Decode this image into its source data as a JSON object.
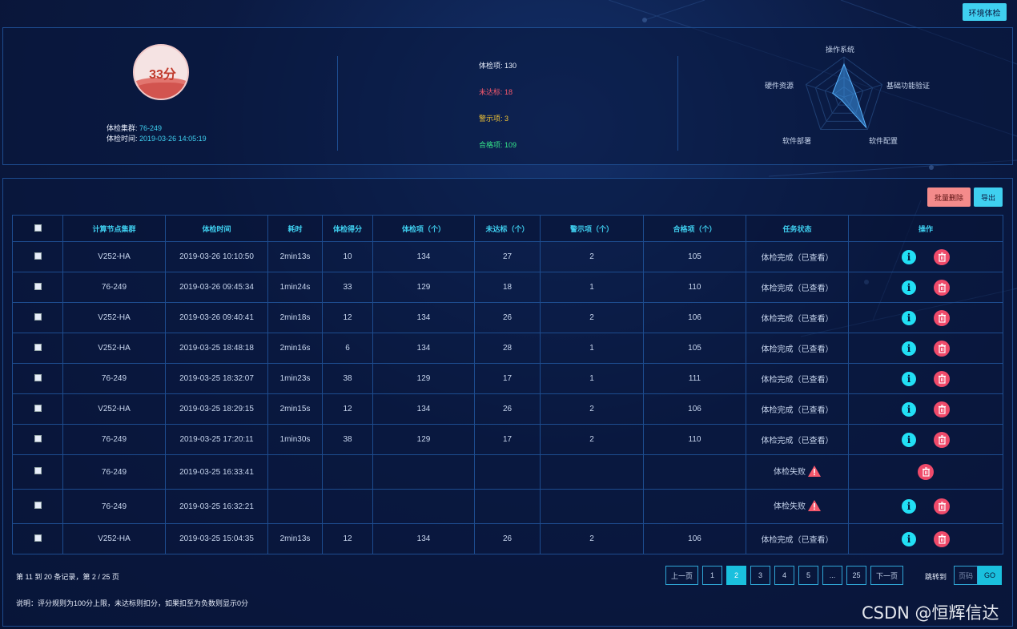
{
  "header": {
    "env_check_button": "环境体检"
  },
  "summary": {
    "score": "33分",
    "cluster_label": "体检集群:",
    "cluster_value": "76-249",
    "time_label": "体检时间:",
    "time_value": "2019-03-26 14:05:19",
    "stats": [
      {
        "label": "体检项:",
        "value": "130",
        "color": "#e8eefb"
      },
      {
        "label": "未达标:",
        "value": "18",
        "color": "#f5586c"
      },
      {
        "label": "警示项:",
        "value": "3",
        "color": "#f3c534"
      },
      {
        "label": "合格项:",
        "value": "109",
        "color": "#35e58a"
      }
    ],
    "radar": {
      "labels": [
        "操作系统",
        "基础功能验证",
        "软件配置",
        "软件部署",
        "硬件资源"
      ],
      "values": [
        0.82,
        0.3,
        0.95,
        0.1,
        0.3
      ]
    }
  },
  "toolbar": {
    "batch_delete": "批量删除",
    "export": "导出"
  },
  "table": {
    "columns": [
      "计算节点集群",
      "体检时间",
      "耗时",
      "体检得分",
      "体检项（个）",
      "未达标（个）",
      "警示项（个）",
      "合格项（个）",
      "任务状态",
      "操作"
    ],
    "rows": [
      {
        "cluster": "V252-HA",
        "time": "2019-03-26 10:10:50",
        "duration": "2min13s",
        "score": "10",
        "items": "134",
        "failed": "27",
        "warnings": "2",
        "passed": "105",
        "status": "体检完成（已查看）",
        "ok": true
      },
      {
        "cluster": "76-249",
        "time": "2019-03-26 09:45:34",
        "duration": "1min24s",
        "score": "33",
        "items": "129",
        "failed": "18",
        "warnings": "1",
        "passed": "110",
        "status": "体检完成（已查看）",
        "ok": true
      },
      {
        "cluster": "V252-HA",
        "time": "2019-03-26 09:40:41",
        "duration": "2min18s",
        "score": "12",
        "items": "134",
        "failed": "26",
        "warnings": "2",
        "passed": "106",
        "status": "体检完成（已查看）",
        "ok": true
      },
      {
        "cluster": "V252-HA",
        "time": "2019-03-25 18:48:18",
        "duration": "2min16s",
        "score": "6",
        "items": "134",
        "failed": "28",
        "warnings": "1",
        "passed": "105",
        "status": "体检完成（已查看）",
        "ok": true
      },
      {
        "cluster": "76-249",
        "time": "2019-03-25 18:32:07",
        "duration": "1min23s",
        "score": "38",
        "items": "129",
        "failed": "17",
        "warnings": "1",
        "passed": "111",
        "status": "体检完成（已查看）",
        "ok": true
      },
      {
        "cluster": "V252-HA",
        "time": "2019-03-25 18:29:15",
        "duration": "2min15s",
        "score": "12",
        "items": "134",
        "failed": "26",
        "warnings": "2",
        "passed": "106",
        "status": "体检完成（已查看）",
        "ok": true
      },
      {
        "cluster": "76-249",
        "time": "2019-03-25 17:20:11",
        "duration": "1min30s",
        "score": "38",
        "items": "129",
        "failed": "17",
        "warnings": "2",
        "passed": "110",
        "status": "体检完成（已查看）",
        "ok": true
      },
      {
        "cluster": "76-249",
        "time": "2019-03-25 16:33:41",
        "duration": "",
        "score": "",
        "items": "",
        "failed": "",
        "warnings": "",
        "passed": "",
        "status": "体检失败",
        "ok": false,
        "info": false
      },
      {
        "cluster": "76-249",
        "time": "2019-03-25 16:32:21",
        "duration": "",
        "score": "",
        "items": "",
        "failed": "",
        "warnings": "",
        "passed": "",
        "status": "体检失败",
        "ok": false,
        "info": true
      },
      {
        "cluster": "V252-HA",
        "time": "2019-03-25 15:04:35",
        "duration": "2min13s",
        "score": "12",
        "items": "134",
        "failed": "26",
        "warnings": "2",
        "passed": "106",
        "status": "体检完成（已查看）",
        "ok": true
      }
    ]
  },
  "pagination": {
    "info": "第 11 到 20 条记录，第 2 / 25 页",
    "prev": "上一页",
    "pages": [
      "1",
      "2",
      "3",
      "4",
      "5",
      "...",
      "25"
    ],
    "active_page": "2",
    "next": "下一页",
    "jump_label": "跳转到",
    "jump_placeholder": "页码",
    "go": "GO"
  },
  "note": "说明：评分规则为100分上限，未达标则扣分，如果扣至为负数则显示0分",
  "watermark": "CSDN @恒辉信达",
  "colors": {
    "accent": "#3fd0f0",
    "danger": "#ef4a6a",
    "warning": "#f5586c",
    "info_icon": "#22e0f5"
  }
}
